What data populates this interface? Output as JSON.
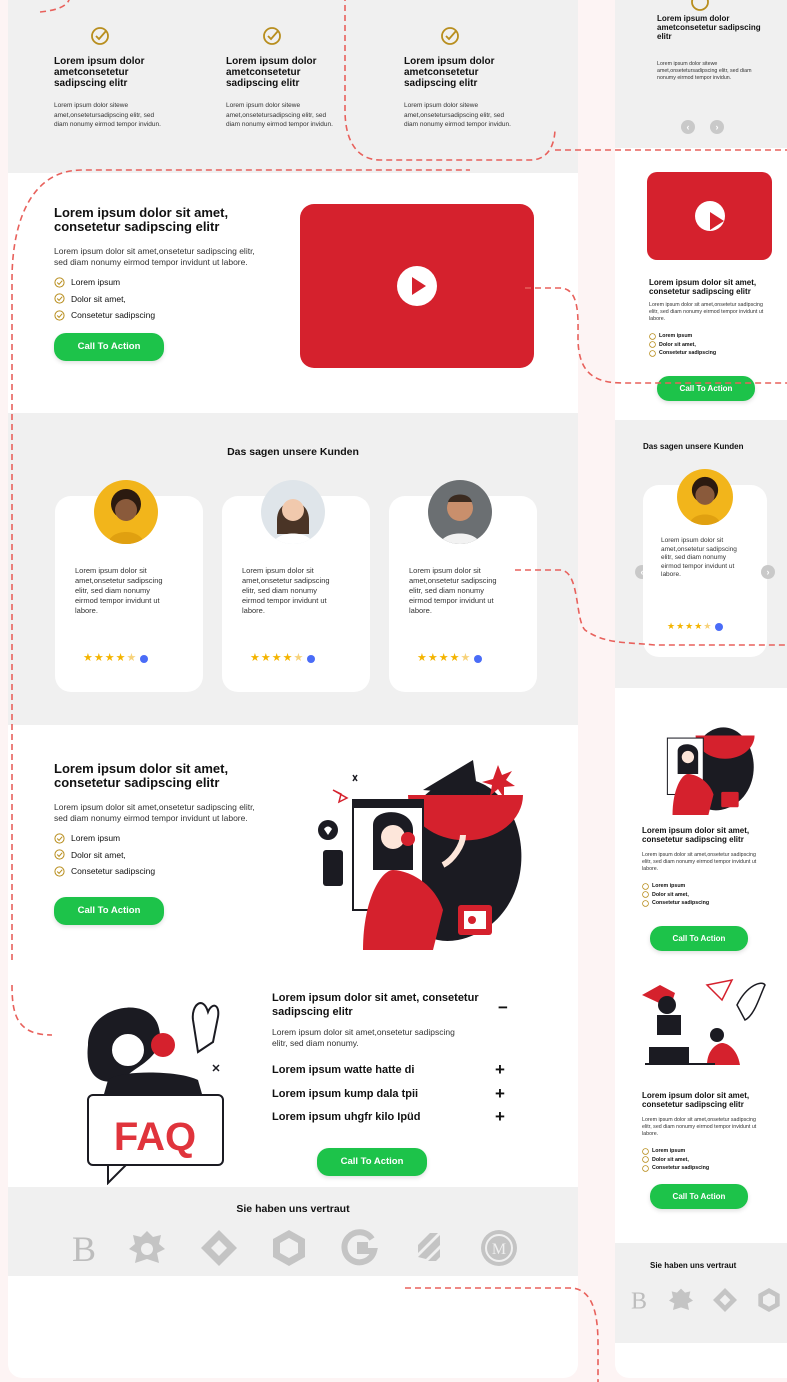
{
  "colors": {
    "accent": "#d5212d",
    "cta": "#1dc34a",
    "section_bg": "#f0f0f0",
    "star": "#f4b400"
  },
  "features": [
    {
      "title": "Lorem ipsum dolor ametconsetetur sadipscing elitr",
      "text": "Lorem ipsum dolor sitewe amet,onsetetursadipscing elitr, sed diam nonumy eirmod tempor invidun."
    },
    {
      "title": "Lorem ipsum dolor ametconsetetur sadipscing elitr",
      "text": "Lorem ipsum dolor sitewe amet,onsetetursadipscing elitr, sed diam nonumy eirmod tempor invidun."
    },
    {
      "title": "Lorem ipsum dolor ametconsetetur sadipscing elitr",
      "text": "Lorem ipsum dolor sitewe amet,onsetetursadipscing elitr, sed diam nonumy eirmod tempor invidun."
    }
  ],
  "hero": {
    "title": "Lorem ipsum dolor sit amet, consetetur sadipscing elitr",
    "text": "Lorem ipsum dolor sit amet,onsetetur sadipscing elitr, sed diam nonumy eirmod tempor invidunt ut labore.",
    "list": [
      "Lorem ipsum",
      "Dolor sit amet,",
      "Consetetur sadipscing"
    ],
    "cta": "Call To Action"
  },
  "reviews": {
    "title": "Das sagen unsere Kunden",
    "text": "Lorem ipsum dolor sit amet,onsetetur sadipscing elitr, sed diam nonumy eirmod tempor invidunt ut labore.",
    "rating": 4.5
  },
  "illustration_section": {
    "title": "Lorem ipsum dolor sit amet, consetetur sadipscing elitr",
    "text": "Lorem ipsum dolor sit amet,onsetetur sadipscing elitr, sed diam nonumy eirmod tempor invidunt ut labore.",
    "list": [
      "Lorem ipsum",
      "Dolor sit amet,",
      "Consetetur sadipscing"
    ],
    "cta": "Call To Action"
  },
  "faq": {
    "badge": "FAQ",
    "open_question": "Lorem ipsum dolor sit amet, consetetur sadipscing elitr",
    "open_answer": "Lorem ipsum dolor sit amet,onsetetur sadipscing elitr, sed diam nonumy.",
    "collapse_icon": "−",
    "questions": [
      "Lorem ipsum watte hatte di",
      "Lorem ipsum kump dala tpii",
      "Lorem ipsum uhgfr kilo Ipüd"
    ],
    "expand_icon": "+",
    "cta": "Call To Action"
  },
  "trust": {
    "title": "Sie haben uns vertraut",
    "logos": [
      "B",
      "crest",
      "diamond",
      "hexagon",
      "G",
      "slash-mark",
      "M"
    ]
  },
  "mobile": {
    "feature_title": "Lorem ipsum dolor ametconsetetur sadipscing elitr",
    "feature_text": "Lorem ipsum dolor sitewe amet,onsetetursadipscing elitr, sed diam nonumy eirmod tempor invidun.",
    "prev": "‹",
    "next": "›",
    "block_title": "Lorem ipsum dolor sit amet, consetetur sadipscing elitr",
    "block_text": "Lorem ipsum dolor sit amet,onsetetur sadipscing elitr, sed diam nonumy eirmod tempor invidunt ut labore.",
    "list": [
      "Lorem ipsum",
      "Dolor sit amet,",
      "Consetetur sadipscing"
    ],
    "cta": "Call To Action",
    "reviews_title": "Das sagen unsere Kunden",
    "review_text": "Lorem ipsum dolor sit amet,onsetetur sadipscing elitr, sed diam nonumy eirmod tempor invidunt ut labore.",
    "trust_title": "Sie haben uns vertraut"
  }
}
